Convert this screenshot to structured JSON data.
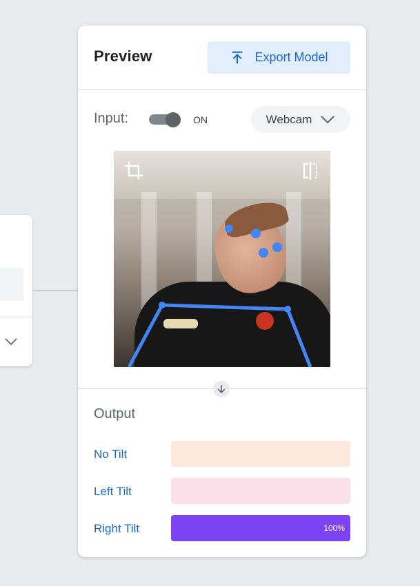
{
  "panel": {
    "title": "Preview",
    "export_label": "Export Model",
    "input_label": "Input:",
    "toggle_state": "ON",
    "source_label": "Webcam",
    "output_title": "Output"
  },
  "classes": [
    {
      "label": "No Tilt",
      "value": 0,
      "value_label": "",
      "track_color": "#fce8dc",
      "fill_color": "#f7c7a8"
    },
    {
      "label": "Left Tilt",
      "value": 0,
      "value_label": "",
      "track_color": "#fbe0ea",
      "fill_color": "#f4a3c0"
    },
    {
      "label": "Right Tilt",
      "value": 1.0,
      "value_label": "100%",
      "track_color": "#e9defd",
      "fill_color": "#7b43f1"
    }
  ],
  "colors": {
    "accent": "#1967d2",
    "keypoint": "#4285f4",
    "background": "#e8eaed"
  },
  "icons": [
    "export-upload-icon",
    "chevron-down-icon",
    "crop-icon",
    "flip-icon",
    "arrow-down-icon"
  ]
}
